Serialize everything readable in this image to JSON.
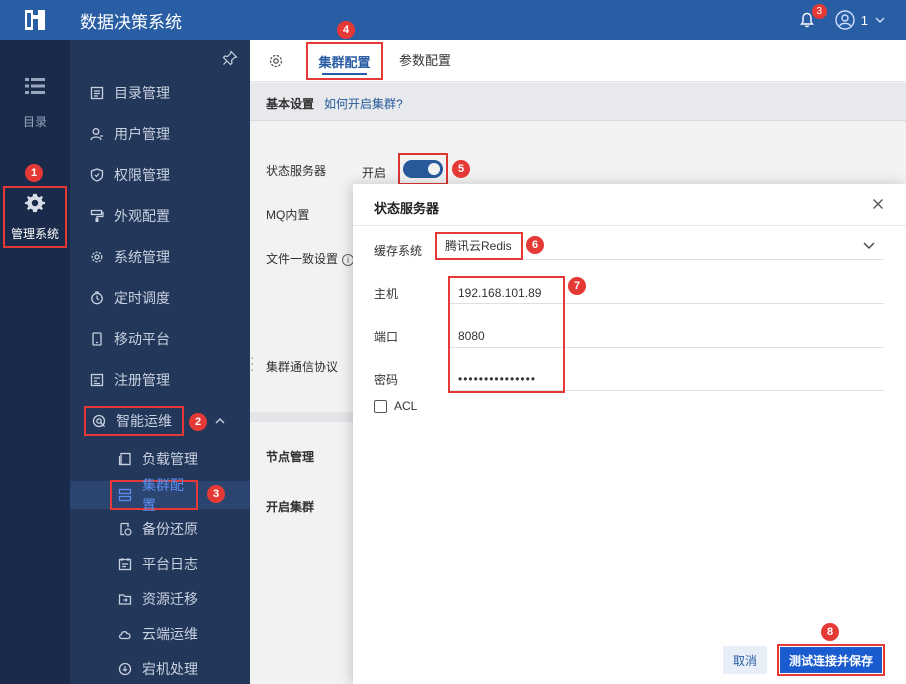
{
  "app": {
    "title": "数据决策系统",
    "notifications_count": "3",
    "user_name": "1"
  },
  "rail": {
    "catalog_label": "目录",
    "admin_label": "管理系统"
  },
  "sidebar": {
    "items": [
      {
        "label": "目录管理",
        "icon": "list-icon"
      },
      {
        "label": "用户管理",
        "icon": "user-icon"
      },
      {
        "label": "权限管理",
        "icon": "shield-icon"
      },
      {
        "label": "外观配置",
        "icon": "paint-icon"
      },
      {
        "label": "系统管理",
        "icon": "gear-icon"
      },
      {
        "label": "定时调度",
        "icon": "clock-icon"
      },
      {
        "label": "移动平台",
        "icon": "mobile-icon"
      },
      {
        "label": "注册管理",
        "icon": "register-icon"
      },
      {
        "label": "智能运维",
        "icon": "ops-icon"
      }
    ],
    "sub_items": [
      {
        "label": "负载管理"
      },
      {
        "label": "集群配置"
      },
      {
        "label": "备份还原"
      },
      {
        "label": "平台日志"
      },
      {
        "label": "资源迁移"
      },
      {
        "label": "云端运维"
      },
      {
        "label": "宕机处理"
      }
    ]
  },
  "tabs": {
    "cluster": "集群配置",
    "params": "参数配置"
  },
  "section": {
    "title": "基本设置",
    "link": "如何开启集群?"
  },
  "form": {
    "status_server_label": "状态服务器",
    "status_on_label": "开启",
    "mq_label": "MQ内置",
    "file_consistency_label": "文件一致设置",
    "protocol_label": "集群通信协议",
    "node_mgmt_label": "节点管理",
    "enable_cluster_label": "开启集群"
  },
  "dialog": {
    "title": "状态服务器",
    "cache_label": "缓存系统",
    "cache_value": "腾讯云Redis",
    "host_label": "主机",
    "host_value": "192.168.101.89",
    "port_label": "端口",
    "port_value": "8080",
    "password_label": "密码",
    "password_value": "•••••••••••••••",
    "acl_label": "ACL",
    "cancel_label": "取消",
    "save_label": "测试连接并保存"
  },
  "markers": [
    "1",
    "2",
    "3",
    "4",
    "5",
    "6",
    "7",
    "8"
  ],
  "colors": {
    "topbar": "#2a5ea4",
    "rail": "#1a2a4a",
    "sidebar": "#23375a",
    "highlight": "#e53935",
    "primary_button": "#1a5ccf"
  }
}
